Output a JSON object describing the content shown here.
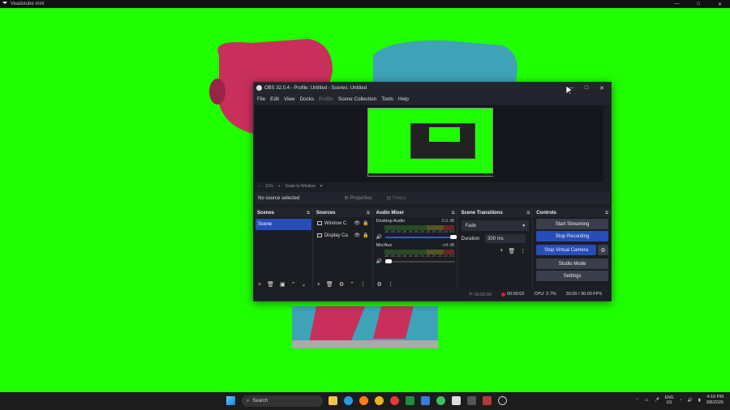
{
  "app_bar": {
    "title": "Veadotube mini"
  },
  "obs": {
    "title": "OBS 32.0.4 - Profile: Untitled - Scenes: Untitled",
    "menu": [
      "File",
      "Edit",
      "View",
      "Docks",
      "Profile",
      "Scene Collection",
      "Tools",
      "Help"
    ],
    "zoom": "11%",
    "scale_mode": "Scale to Window",
    "no_source": "No source selected",
    "properties_label": "Properties",
    "filters_label": "Filters",
    "docks": {
      "scenes": {
        "title": "Scenes",
        "items": [
          "Scene"
        ]
      },
      "sources": {
        "title": "Sources",
        "items": [
          "Window C",
          "Display Ca"
        ]
      },
      "mixer": {
        "title": "Audio Mixer",
        "channels": [
          {
            "name": "Desktop Audio",
            "db": "0.0 dB"
          },
          {
            "name": "Mic/Aux",
            "db": "-inf dB"
          }
        ],
        "ticks": "-60 -55 -50 -45 -40 -35 -30 -25 -20 -15 -10 -5 0"
      },
      "transitions": {
        "title": "Scene Transitions",
        "selected": "Fade",
        "duration_label": "Duration",
        "duration": "300 ms"
      },
      "controls": {
        "title": "Controls",
        "start_streaming": "Start Streaming",
        "stop_recording": "Stop Recording",
        "stop_virtual_camera": "Stop Virtual Camera",
        "studio_mode": "Studio Mode",
        "settings": "Settings"
      }
    },
    "status": {
      "stream_time": "00:00:00",
      "rec_time": "00:00:02",
      "cpu": "CPU: 2.7%",
      "fps": "30.00 / 30.00 FPS"
    }
  },
  "taskbar": {
    "search_placeholder": "Search",
    "lang_top": "ENG",
    "lang_bottom": "US",
    "time": "4:16 PM",
    "date": "3/8/2026"
  }
}
